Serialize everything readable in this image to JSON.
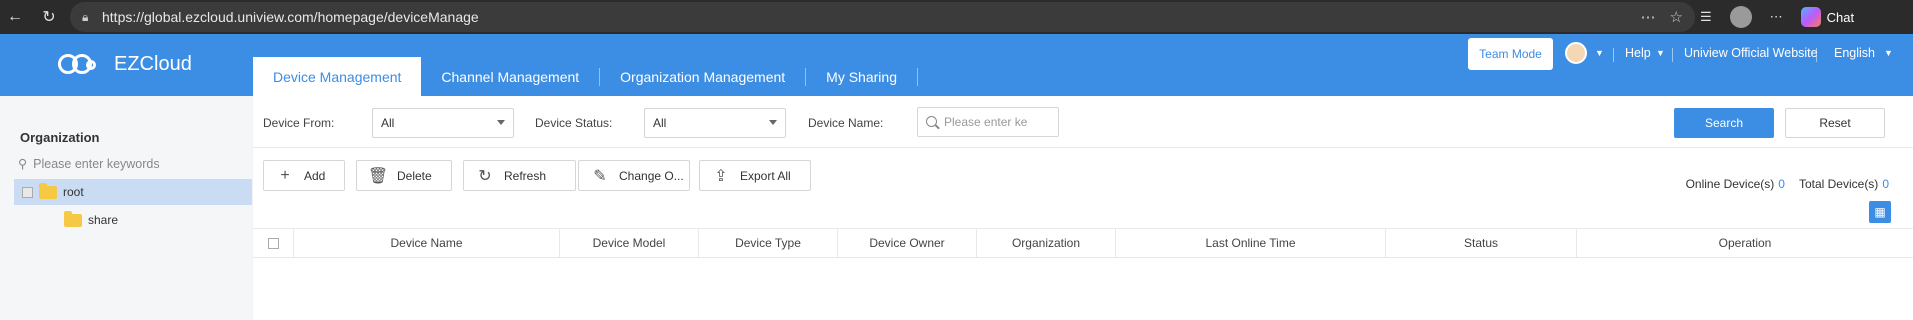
{
  "browser": {
    "url": "https://global.ezcloud.uniview.com/homepage/deviceManage",
    "chat_label": "Chat"
  },
  "header": {
    "logo_text": "EZCloud",
    "tabs": [
      {
        "label": "Device Management",
        "active": true
      },
      {
        "label": "Channel Management",
        "active": false
      },
      {
        "label": "Organization Management",
        "active": false
      },
      {
        "label": "My Sharing",
        "active": false
      }
    ],
    "team_mode": "Team Mode",
    "help": "Help",
    "official_website": "Uniview Official Website",
    "language": "English"
  },
  "sidebar": {
    "title": "Organization",
    "search_placeholder": "Please enter keywords",
    "tree": [
      {
        "label": "root",
        "selected": true
      },
      {
        "label": "share",
        "selected": false
      }
    ]
  },
  "filters": {
    "device_from_label": "Device From:",
    "device_from_value": "All",
    "device_status_label": "Device Status:",
    "device_status_value": "All",
    "device_name_label": "Device Name:",
    "device_name_placeholder": "Please enter ke",
    "search_button": "Search",
    "reset_button": "Reset"
  },
  "toolbar": {
    "add": "Add",
    "delete": "Delete",
    "refresh": "Refresh",
    "change_owner": "Change O...",
    "export_all": "Export All",
    "online_label": "Online Device(s)",
    "online_count": "0",
    "total_label": "Total Device(s)",
    "total_count": "0"
  },
  "table": {
    "columns": [
      "Device Name",
      "Device Model",
      "Device Type",
      "Device Owner",
      "Organization",
      "Last Online Time",
      "Status",
      "Operation"
    ]
  },
  "colors": {
    "accent": "#3c8de4",
    "selected_row": "#c9dcf3"
  }
}
